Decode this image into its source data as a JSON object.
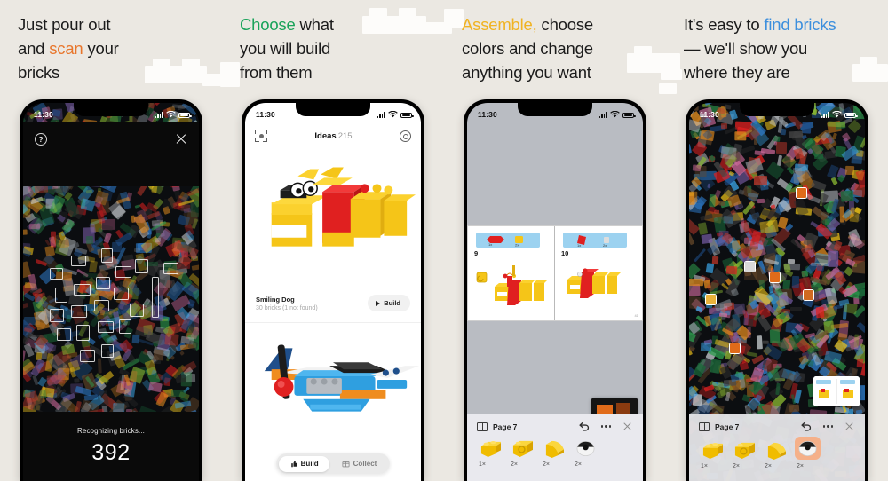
{
  "theme": {
    "background": "#ebe8e2",
    "deco_brick_color": "#fdfcfa",
    "accent_orange": "#e8762c",
    "accent_green": "#1aa35a",
    "accent_yellow": "#f0b323",
    "accent_blue": "#3d8fdd",
    "heading_color": "#1b1b1b",
    "highlight_chip": "#f5b089"
  },
  "panels": [
    {
      "id": "scan",
      "headline": {
        "accent_text": "",
        "accent_position": "mid",
        "lead": "Just pour out",
        "mid_pre": "and ",
        "accent": "scan",
        "mid_post": " your",
        "tail": "bricks",
        "accent_color": "#e8762c"
      },
      "phone": {
        "status": {
          "time": "11:30",
          "signal": "signal-bars-icon",
          "wifi": "wifi-icon",
          "battery": "battery-full-icon",
          "tint": "light"
        },
        "topbar": {
          "left_icon": "help-circle-icon",
          "right_icon": "close-icon"
        },
        "overlay": {
          "label": "Recognizing bricks...",
          "count": "392"
        }
      }
    },
    {
      "id": "ideas",
      "headline": {
        "accent": "Choose",
        "mid_post": " what",
        "lead2": "you will build",
        "tail": "from them",
        "accent_color": "#1aa35a"
      },
      "phone": {
        "status": {
          "time": "11:30",
          "tint": "dark"
        },
        "nav": {
          "left_icon": "scan-frame-icon",
          "title": "Ideas",
          "count": "215",
          "right_icon": "gear-icon"
        },
        "cards": [
          {
            "title": "Smiling Dog",
            "subtitle": "30 bricks (1 not found)",
            "action_label": "Build",
            "action_icon": "play-icon",
            "model": "dog"
          },
          {
            "title": "",
            "subtitle": "",
            "action_label": "",
            "model": "plane"
          }
        ],
        "segmented": [
          {
            "label": "Build",
            "icon": "thumb-build-icon",
            "selected": true
          },
          {
            "label": "Collect",
            "icon": "box-collect-icon",
            "selected": false
          }
        ]
      }
    },
    {
      "id": "assemble",
      "headline": {
        "accent": "Assemble,",
        "mid_post": " choose",
        "lead2": "colors and change",
        "tail": "anything you want",
        "accent_color": "#f0b323"
      },
      "phone": {
        "status": {
          "time": "11:30",
          "tint": "dark"
        },
        "instructions": {
          "left_page": "9",
          "right_page": "10",
          "corner_page": "41"
        },
        "toolbar": {
          "book_icon": "book-icon",
          "page_label": "Page 7",
          "undo_icon": "undo-icon",
          "more_icon": "more-dots-icon",
          "close_icon": "close-icon",
          "bricks": [
            {
              "count": "1×",
              "color": "#f4c300",
              "shape": "brick-2x2",
              "highlighted": false
            },
            {
              "count": "2×",
              "color": "#f4c300",
              "shape": "brick-2x2-round",
              "highlighted": false
            },
            {
              "count": "2×",
              "color": "#f4c300",
              "shape": "slope-2x2",
              "highlighted": false
            },
            {
              "count": "2×",
              "color": "#efefef",
              "shape": "eye-dish",
              "highlighted": false
            }
          ]
        }
      }
    },
    {
      "id": "find",
      "headline": {
        "lead": "It's easy to ",
        "accent": "find bricks",
        "lead2": "— we'll show you",
        "tail": "where they are",
        "accent_color": "#3d8fdd"
      },
      "phone": {
        "status": {
          "time": "11:30",
          "tint": "light"
        },
        "markers_count": 6,
        "mini_preview": "instruction-thumbnail",
        "toolbar": {
          "book_icon": "book-icon",
          "page_label": "Page 7",
          "undo_icon": "undo-icon",
          "more_icon": "more-dots-icon",
          "close_icon": "close-icon",
          "bricks": [
            {
              "count": "1×",
              "color": "#f4c300",
              "shape": "brick-2x2",
              "highlighted": false
            },
            {
              "count": "2×",
              "color": "#f4c300",
              "shape": "brick-2x2-round",
              "highlighted": false
            },
            {
              "count": "2×",
              "color": "#f4c300",
              "shape": "slope-2x2",
              "highlighted": false
            },
            {
              "count": "2×",
              "color": "#efefef",
              "shape": "eye-dish",
              "highlighted": true
            }
          ]
        }
      }
    }
  ]
}
